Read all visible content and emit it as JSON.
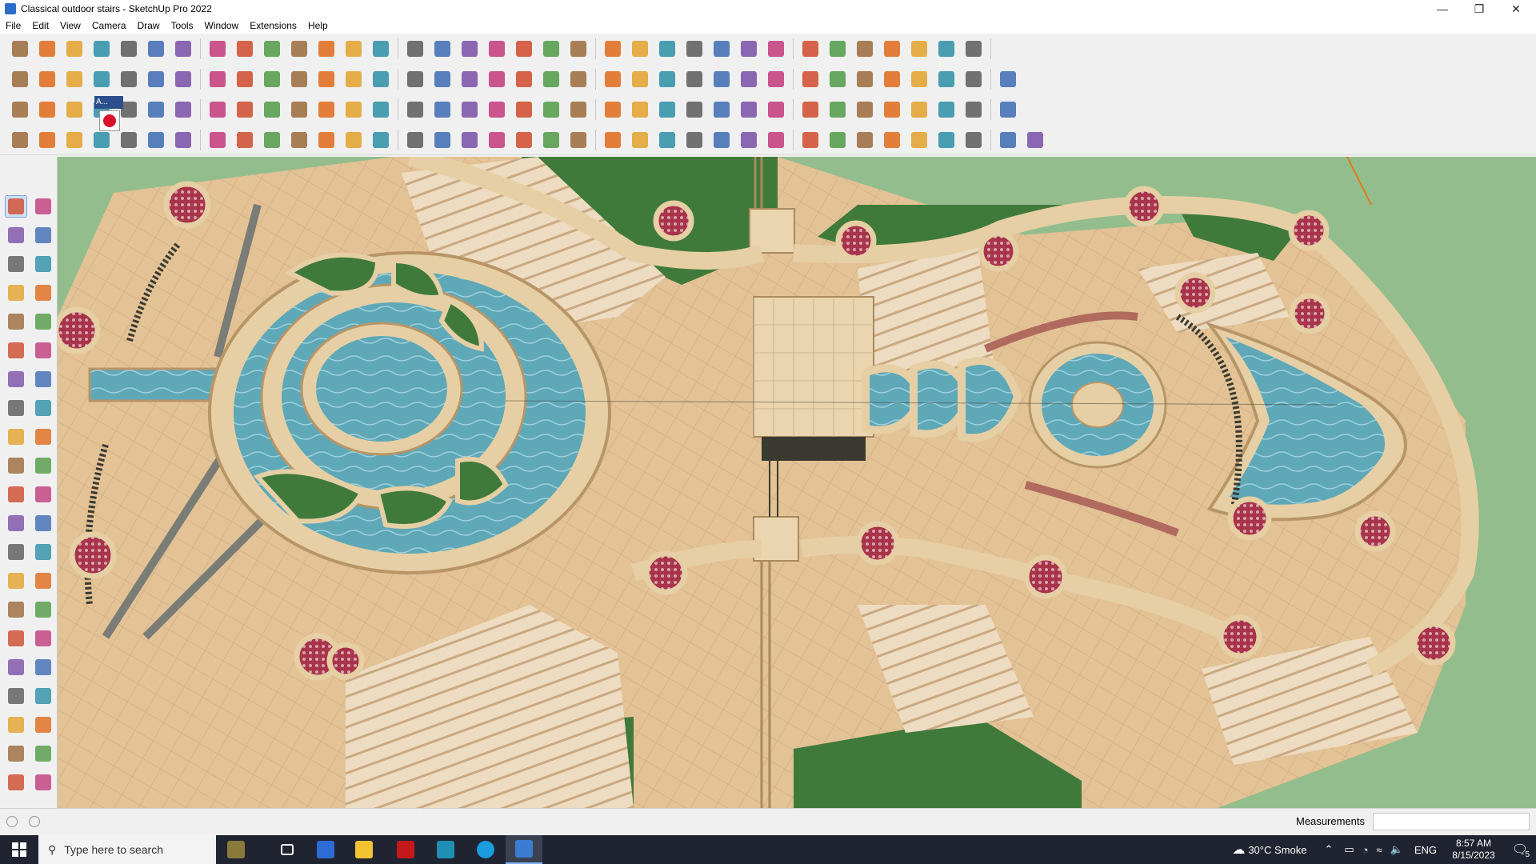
{
  "window": {
    "title": "Classical outdoor stairs - SketchUp Pro 2022",
    "minimize_symbol": "—",
    "restore_symbol": "❐",
    "close_symbol": "✕"
  },
  "menu": [
    "File",
    "Edit",
    "View",
    "Camera",
    "Draw",
    "Tools",
    "Window",
    "Extensions",
    "Help"
  ],
  "toolbars": {
    "row1": [
      "search",
      "select",
      "eraser",
      "pencil",
      "lasso",
      "paint",
      "push-pull",
      "follow-me",
      "move",
      "rotate",
      "scale",
      "tape",
      "text",
      "paint-bucket",
      "orbit",
      "pan",
      "zoom",
      "zoom-extents",
      "section-plane",
      "section-fill",
      "layer",
      "component",
      "profile",
      "style",
      "warehouse",
      "sandbox-from-contours",
      "sandbox-from-scratch",
      "add-detail",
      "smoove",
      "stamp",
      "drape",
      "flip-edge",
      "undo",
      "redo",
      "help"
    ],
    "row2": [
      "iso",
      "top",
      "front",
      "right",
      "back",
      "left",
      "bottom",
      "wireframe",
      "hidden-line",
      "shaded",
      "textured",
      "monochrome",
      "xray",
      "back-edges",
      "house",
      "shed",
      "warehouse-tool",
      "extension-warehouse",
      "layout",
      "classifier",
      "style-builder",
      "profile-builder",
      "curve",
      "arc",
      "polygon",
      "circle",
      "freehand",
      "rectangle",
      "line",
      "offset",
      "pushpull2",
      "tape2",
      "dimension",
      "protractor",
      "axes",
      "3dtext"
    ],
    "row3": [
      "fill-a",
      "fill-b",
      "fill-c",
      "curic-1",
      "curic-2",
      "curic-3",
      "curic-4",
      "curic-5",
      "curic-6",
      "curic-7",
      "curic-8",
      "curic-9",
      "curic-10",
      "curic-11",
      "curic-12",
      "curic-13",
      "curic-14",
      "curic-15",
      "curic-16",
      "curic-17",
      "curic-18",
      "curic-19",
      "curic-20",
      "curic-21",
      "curic-22",
      "curic-23",
      "curic-24",
      "curic-25",
      "curic-26",
      "curic-27",
      "curic-28",
      "curic-29",
      "curic-30",
      "curic-31",
      "curic-32",
      "curic-33"
    ],
    "row4": [
      "sel-a",
      "sel-b",
      "sel-c",
      "tool-4",
      "tool-5",
      "tool-6",
      "tool-7",
      "tool-8",
      "tool-9",
      "tool-10",
      "tool-11",
      "tool-12",
      "tool-13",
      "tool-14",
      "tool-15",
      "tool-16",
      "tool-17",
      "tool-18",
      "tool-19",
      "tool-20",
      "tool-21",
      "tool-22",
      "tool-23",
      "tool-24",
      "tool-25",
      "tool-26",
      "tool-27",
      "tool-28",
      "tool-29",
      "tool-30",
      "tool-31",
      "tool-32",
      "tool-33",
      "tool-34",
      "tool-35",
      "tool-36",
      "tool-37",
      "tool-38"
    ],
    "mini_label": "A..."
  },
  "left_palette": [
    "select",
    "orbit-cursor",
    "paint-bucket",
    "eraser",
    "component-tool",
    "tape-tool",
    "line",
    "freehand",
    "rectangle",
    "rotated-rectangle",
    "circle",
    "polygon",
    "arc",
    "arc-2pt",
    "pie",
    "arc-3pt",
    "move",
    "push-pull",
    "rotate",
    "follow-me",
    "scale",
    "offset",
    "tape-measure",
    "dimension",
    "protractor",
    "text",
    "axes",
    "3d-text",
    "orbit",
    "pan",
    "zoom",
    "zoom-window",
    "zoom-extents",
    "previous",
    "position-camera",
    "look-around",
    "walk",
    "section-plane",
    "display-section",
    "section-fill",
    "solid-tools",
    "layers"
  ],
  "status": {
    "measurements_label": "Measurements",
    "measurements_value": ""
  },
  "taskbar": {
    "search_placeholder": "Type here to search",
    "weather": "30°C  Smoke",
    "language": "ENG",
    "time": "8:57 AM",
    "date": "8/15/2023",
    "notifications_count": "5"
  },
  "colors": {
    "paving": "#e3c296",
    "paving_dark": "#d5ad7d",
    "grass": "#3f7a3b",
    "water": "#5fa8b8",
    "stone": "#e6cfa4",
    "planter_flowers": "#a8344a",
    "lawn_bg": "#93bd8c",
    "accent_orange": "#e07a17"
  }
}
